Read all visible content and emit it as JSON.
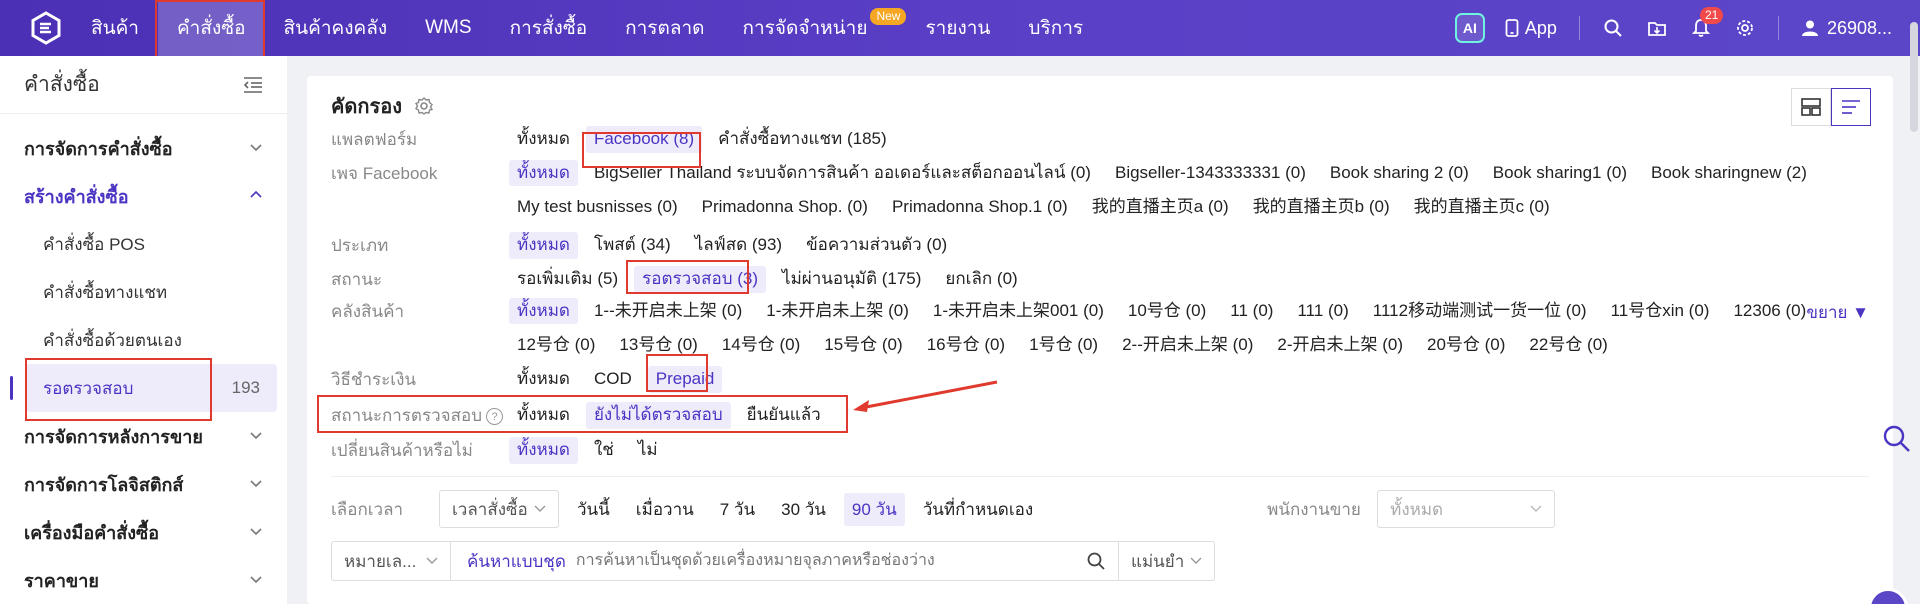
{
  "topbar": {
    "nav": [
      {
        "label": "สินค้า"
      },
      {
        "label": "คำสั่งซื้อ",
        "active": true
      },
      {
        "label": "สินค้าคงคลัง"
      },
      {
        "label": "WMS"
      },
      {
        "label": "การสั่งซื้อ"
      },
      {
        "label": "การตลาด"
      },
      {
        "label": "การจัดจำหน่าย",
        "badge": "New"
      },
      {
        "label": "รายงาน"
      },
      {
        "label": "บริการ"
      }
    ],
    "ai_label": "AI",
    "app_label": "App",
    "notification_count": "21",
    "user_label": "26908...",
    "colors": {
      "start": "#4b2fb4",
      "end": "#5b46c8",
      "accent": "#4a35c3"
    }
  },
  "sidebar": {
    "title": "คำสั่งซื้อ",
    "groups": [
      {
        "label": "การจัดการคำสั่งซื้อ",
        "open": false
      },
      {
        "label": "สร้างคำสั่งซื้อ",
        "open": true,
        "children": [
          {
            "label": "คำสั่งซื้อ POS"
          },
          {
            "label": "คำสั่งซื้อทางแชท"
          },
          {
            "label": "คำสั่งซื้อด้วยตนเอง"
          },
          {
            "label": "รอตรวจสอบ",
            "count": "193",
            "active": true
          }
        ]
      },
      {
        "label": "การจัดการหลังการขาย",
        "open": false
      },
      {
        "label": "การจัดการโลจิสติกส์",
        "open": false
      },
      {
        "label": "เครื่องมือคำสั่งซื้อ",
        "open": false
      },
      {
        "label": "ราคาขาย",
        "open": false
      }
    ]
  },
  "filter": {
    "title": "คัดกรอง",
    "expand_label": "ขยาย ▼",
    "rows": [
      {
        "label": "แพลตฟอร์ม",
        "options": [
          {
            "text": "ทั้งหมด"
          },
          {
            "text": "Facebook (8)",
            "sel": true
          },
          {
            "text": "คำสั่งซื้อทางแชท (185)"
          }
        ]
      },
      {
        "label": "เพจ Facebook",
        "options": [
          {
            "text": "ทั้งหมด",
            "sel": true
          },
          {
            "text": "BigSeller Thailand ระบบจัดการสินค้า ออเดอร์และสต็อกออนไลน์ (0)"
          },
          {
            "text": "Bigseller-1343333331 (0)"
          },
          {
            "text": "Book sharing 2 (0)"
          },
          {
            "text": "Book sharing1 (0)"
          },
          {
            "text": "Book sharingnew (2)"
          },
          {
            "text": "My test busnisses (0)"
          },
          {
            "text": "Primadonna Shop. (0)"
          },
          {
            "text": "Primadonna Shop.1 (0)"
          },
          {
            "text": "我的直播主页a (0)"
          },
          {
            "text": "我的直播主页b (0)"
          },
          {
            "text": "我的直播主页c (0)"
          }
        ]
      },
      {
        "label": "ประเภท",
        "options": [
          {
            "text": "ทั้งหมด",
            "sel": true
          },
          {
            "text": "โพสต์ (34)"
          },
          {
            "text": "ไลฟ์สด (93)"
          },
          {
            "text": "ข้อความส่วนตัว (0)"
          }
        ]
      },
      {
        "label": "สถานะ",
        "options": [
          {
            "text": "รอเพิ่มเติม (5)"
          },
          {
            "text": "รอตรวจสอบ (3)",
            "sel": true
          },
          {
            "text": "ไม่ผ่านอนุมัติ (175)"
          },
          {
            "text": "ยกเลิก (0)"
          }
        ]
      },
      {
        "label": "คลังสินค้า",
        "options": [
          {
            "text": "ทั้งหมด",
            "sel": true
          },
          {
            "text": "1--未开启未上架 (0)"
          },
          {
            "text": "1-未开启未上架 (0)"
          },
          {
            "text": "1-未开启未上架001 (0)"
          },
          {
            "text": "10号仓 (0)"
          },
          {
            "text": "11 (0)"
          },
          {
            "text": "111 (0)"
          },
          {
            "text": "1112移动端测试一货一位 (0)"
          },
          {
            "text": "11号仓xin (0)"
          },
          {
            "text": "12306 (0)"
          },
          {
            "text": "12号仓 (0)"
          },
          {
            "text": "13号仓 (0)"
          },
          {
            "text": "14号仓 (0)"
          },
          {
            "text": "15号仓 (0)"
          },
          {
            "text": "16号仓 (0)"
          },
          {
            "text": "1号仓 (0)"
          },
          {
            "text": "2--开启未上架 (0)"
          },
          {
            "text": "2-开启未上架 (0)"
          },
          {
            "text": "20号仓 (0)"
          },
          {
            "text": "22号仓 (0)"
          }
        ]
      },
      {
        "label": "วิธีชำระเงิน",
        "options": [
          {
            "text": "ทั้งหมด"
          },
          {
            "text": "COD"
          },
          {
            "text": "Prepaid",
            "sel": true
          }
        ]
      },
      {
        "label": "สถานะการตรวจสอบ",
        "options": [
          {
            "text": "ทั้งหมด"
          },
          {
            "text": "ยังไม่ได้ตรวจสอบ",
            "sel": true
          },
          {
            "text": "ยืนยันแล้ว"
          }
        ]
      },
      {
        "label": "เปลี่ยนสินค้าหรือไม่",
        "options": [
          {
            "text": "ทั้งหมด",
            "sel": true
          },
          {
            "text": "ใช่"
          },
          {
            "text": "ไม่"
          }
        ]
      }
    ]
  },
  "time": {
    "label": "เลือกเวลา",
    "type_select": "เวลาสั่งซื้อ",
    "options": [
      {
        "text": "วันนี้"
      },
      {
        "text": "เมื่อวาน"
      },
      {
        "text": "7 วัน"
      },
      {
        "text": "30 วัน"
      },
      {
        "text": "90 วัน",
        "sel": true
      },
      {
        "text": "วันที่กำหนดเอง"
      }
    ],
    "staff_label": "พนักงานขาย",
    "staff_select": "ทั้งหมด"
  },
  "search": {
    "field_select": "หมายเล...",
    "mode_label": "ค้นหาแบบชุด",
    "placeholder": "การค้นหาเป็นชุดด้วยเครื่องหมายจุลภาคหรือช่องว่าง",
    "match_select": "แม่นยำ"
  }
}
